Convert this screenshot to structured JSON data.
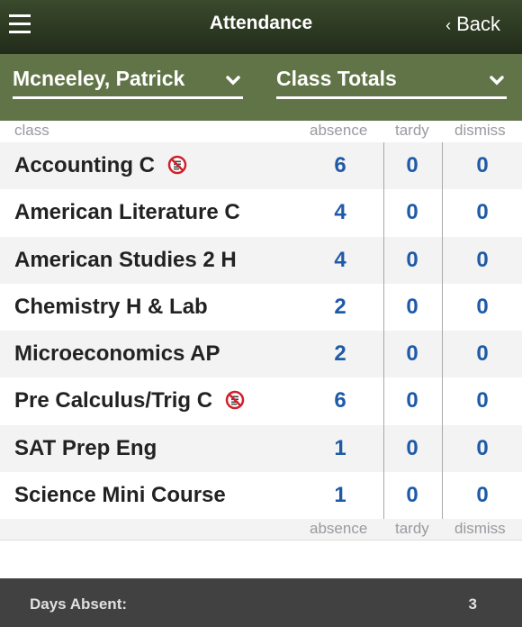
{
  "header": {
    "title": "Attendance",
    "back_label": "Back",
    "menu_icon": "hamburger-menu-icon",
    "back_icon": "chevron-left-icon"
  },
  "filters": {
    "student": "Mcneeley, Patrick",
    "view": "Class Totals"
  },
  "columns": {
    "class": "class",
    "absence": "absence",
    "tardy": "tardy",
    "dismiss": "dismiss"
  },
  "rows": [
    {
      "name": "Accounting C",
      "absence": "6",
      "tardy": "0",
      "dismiss": "0",
      "flag_icon": true
    },
    {
      "name": "American Literature C",
      "absence": "4",
      "tardy": "0",
      "dismiss": "0",
      "flag_icon": false
    },
    {
      "name": "American Studies 2 H",
      "absence": "4",
      "tardy": "0",
      "dismiss": "0",
      "flag_icon": false
    },
    {
      "name": "Chemistry H & Lab",
      "absence": "2",
      "tardy": "0",
      "dismiss": "0",
      "flag_icon": false
    },
    {
      "name": "Microeconomics AP",
      "absence": "2",
      "tardy": "0",
      "dismiss": "0",
      "flag_icon": false
    },
    {
      "name": "Pre Calculus/Trig C",
      "absence": "6",
      "tardy": "0",
      "dismiss": "0",
      "flag_icon": true
    },
    {
      "name": "SAT Prep Eng",
      "absence": "1",
      "tardy": "0",
      "dismiss": "0",
      "flag_icon": false
    },
    {
      "name": "Science Mini Course",
      "absence": "1",
      "tardy": "0",
      "dismiss": "0",
      "flag_icon": false
    }
  ],
  "footer": {
    "label": "Days Absent:",
    "value": "3"
  },
  "colors": {
    "header_bg": "#2e3a22",
    "filter_bg": "#617447",
    "number_blue": "#1f5aa8",
    "footer_bg": "#414141"
  }
}
